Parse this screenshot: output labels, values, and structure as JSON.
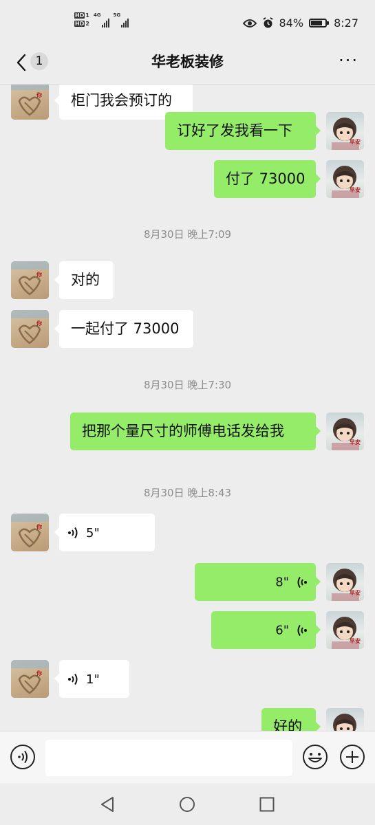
{
  "status": {
    "hd1": "HD",
    "sim1": "1",
    "hd2": "HD",
    "sim2": "2",
    "net1": "4G",
    "net2": "5G",
    "battery_pct": "84%",
    "battery_level": 0.84,
    "time": "8:27"
  },
  "header": {
    "unread_count": "1",
    "title": "华老板装修",
    "more": "···"
  },
  "messages": [
    {
      "type": "text",
      "side": "in",
      "text": "柜门我会预订的"
    },
    {
      "type": "text",
      "side": "out",
      "text": "订好了发我看一下"
    },
    {
      "type": "text",
      "side": "out",
      "text": "付了 73000"
    },
    {
      "type": "time",
      "text": "8月30日 晚上7:09"
    },
    {
      "type": "text",
      "side": "in",
      "text": "对的"
    },
    {
      "type": "text",
      "side": "in",
      "text": "一起付了 73000"
    },
    {
      "type": "time",
      "text": "8月30日 晚上7:30"
    },
    {
      "type": "text",
      "side": "out",
      "text": "把那个量尺寸的师傅电话发给我"
    },
    {
      "type": "time",
      "text": "8月30日 晚上8:43"
    },
    {
      "type": "voice",
      "side": "in",
      "text": "5\""
    },
    {
      "type": "voice",
      "side": "out",
      "text": "8\""
    },
    {
      "type": "voice",
      "side": "out",
      "text": "6\""
    },
    {
      "type": "voice",
      "side": "in",
      "text": "1\""
    },
    {
      "type": "text",
      "side": "out",
      "text": "好的"
    }
  ],
  "avatars": {
    "contact_label": "你",
    "self_label": "早安"
  },
  "colors": {
    "outgoing_bubble": "#95ec69",
    "incoming_bubble": "#ffffff",
    "background": "#ededed"
  },
  "input": {
    "placeholder": ""
  },
  "icons": {
    "back": "chevron-left-icon",
    "voice_toggle": "voice-icon",
    "emoji": "emoji-icon",
    "plus": "plus-icon",
    "nav_back": "triangle-back-icon",
    "nav_home": "circle-home-icon",
    "nav_recent": "square-recent-icon"
  }
}
